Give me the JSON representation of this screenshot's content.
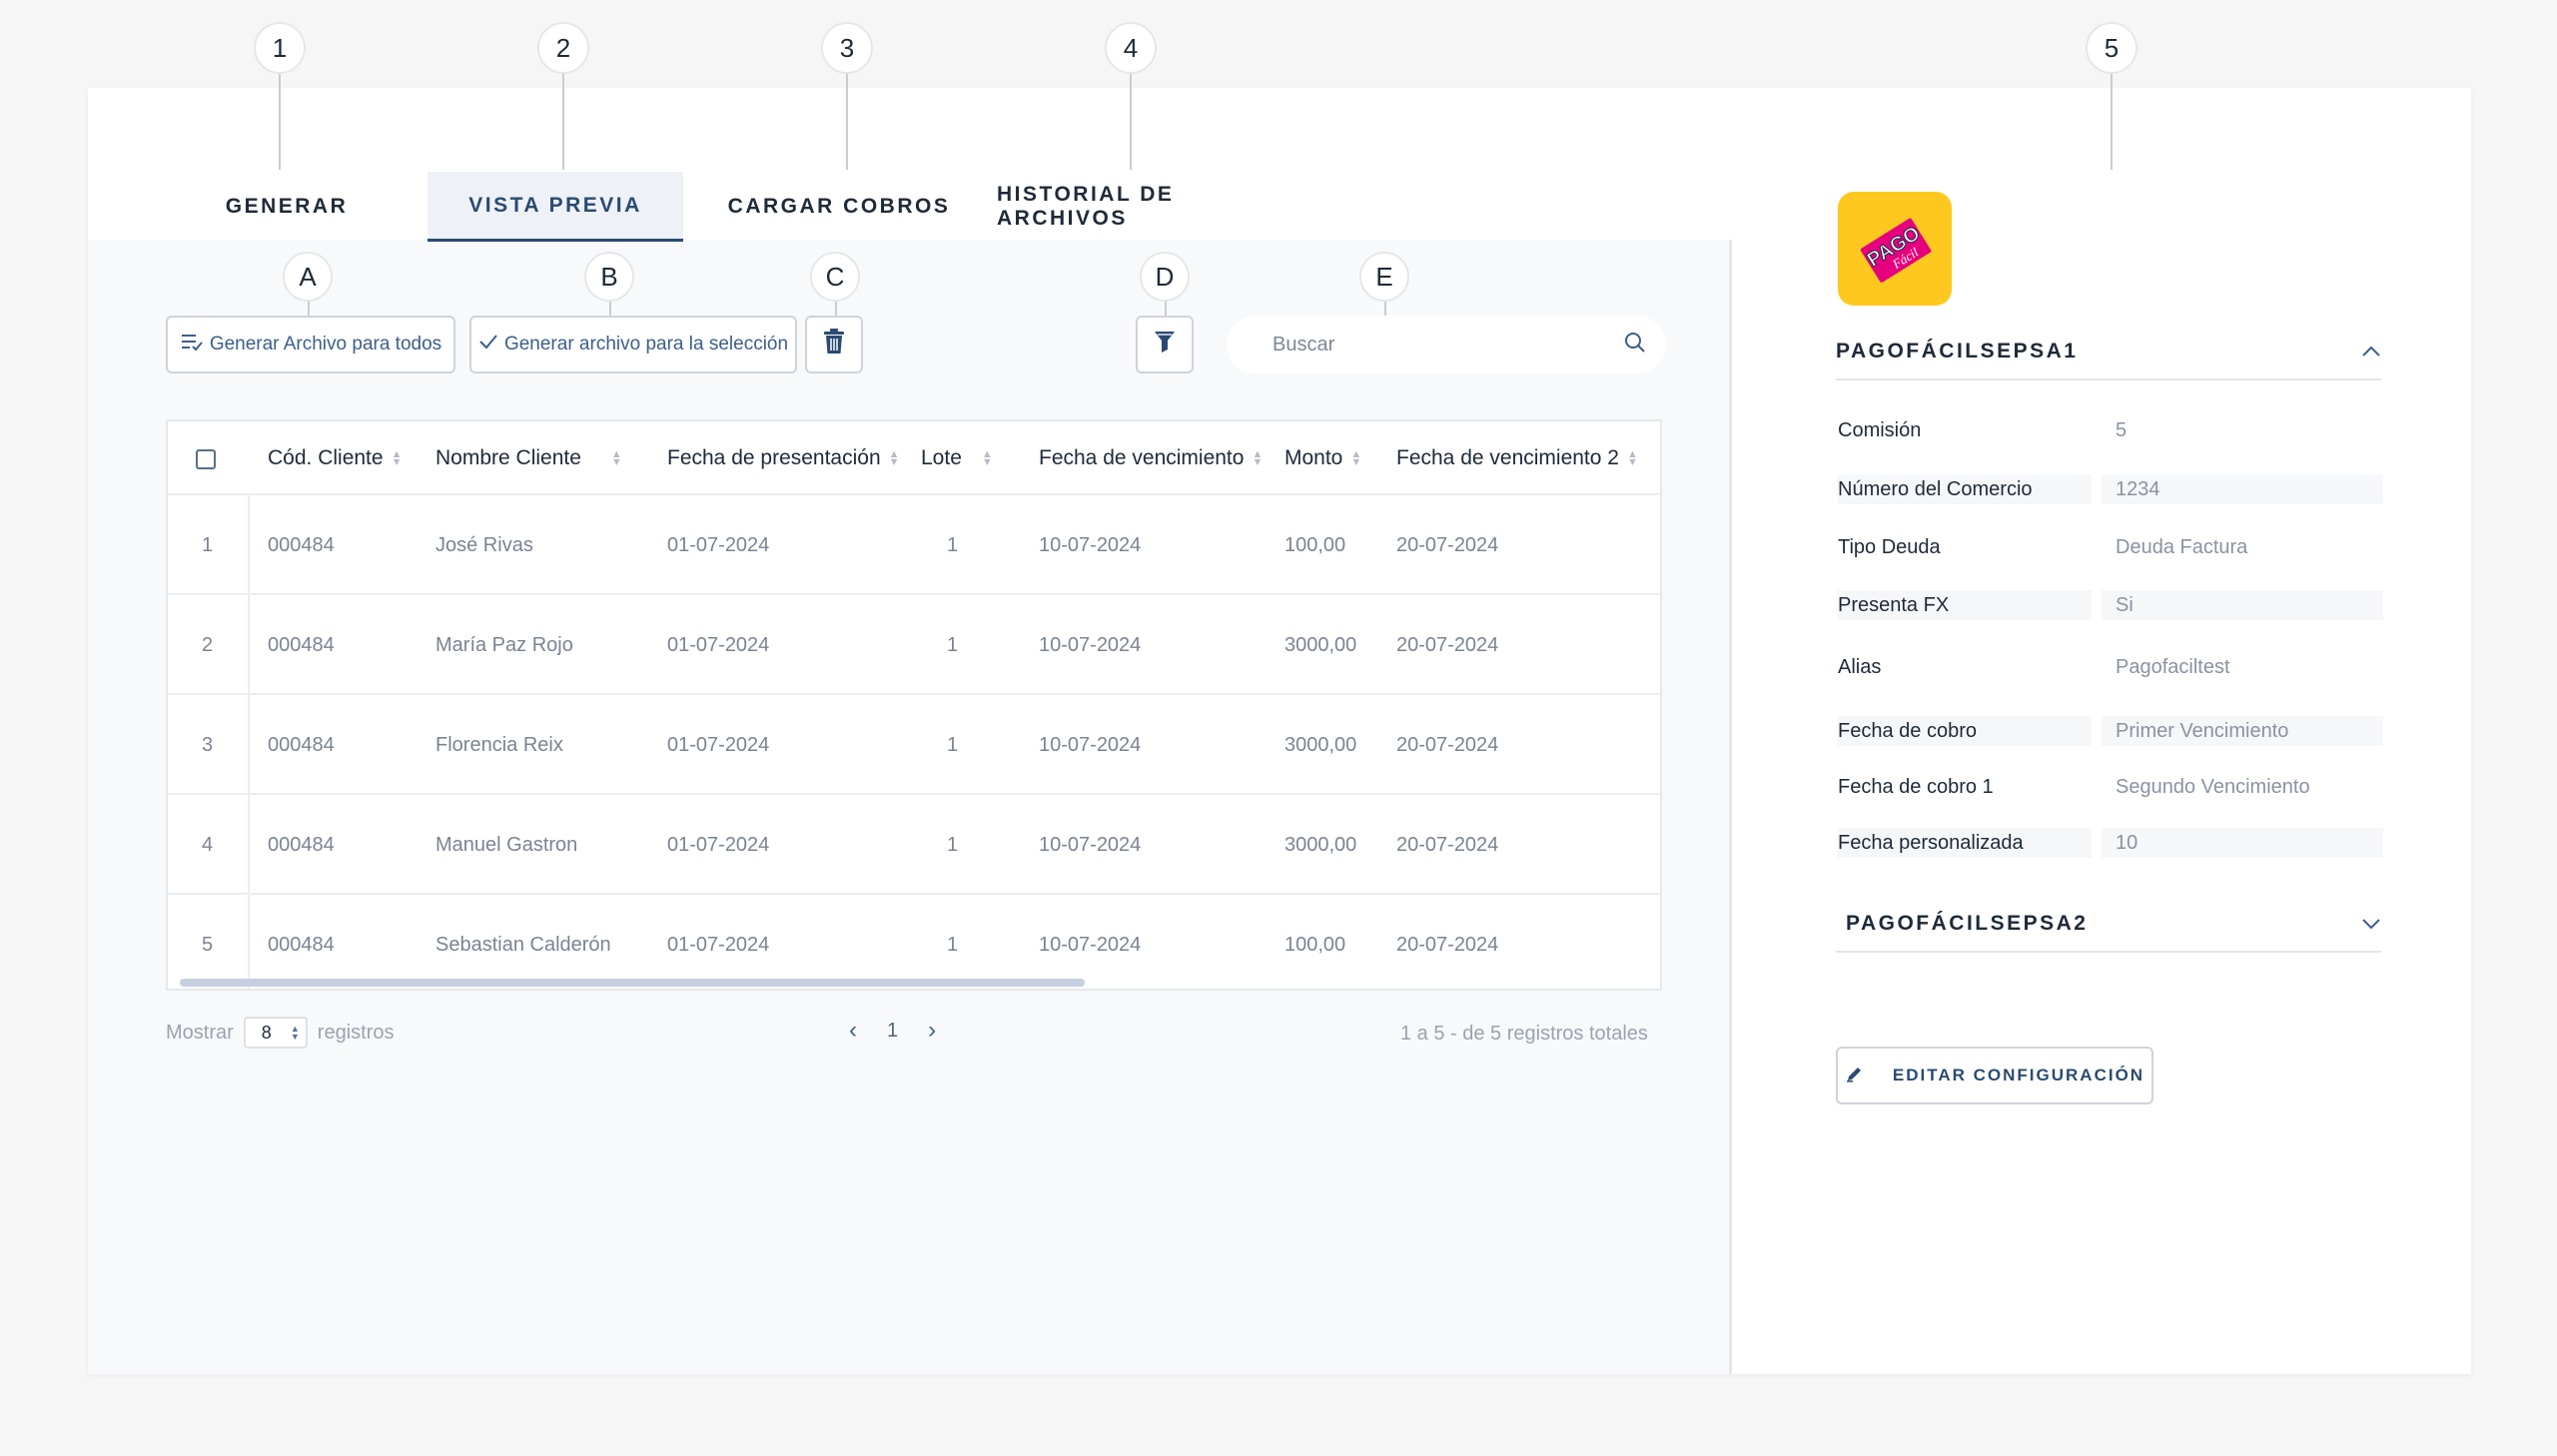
{
  "callouts": {
    "c1": "1",
    "c2": "2",
    "c3": "3",
    "c4": "4",
    "c5": "5",
    "cA": "A",
    "cB": "B",
    "cC": "C",
    "cD": "D",
    "cE": "E"
  },
  "tabs": {
    "generar": "GENERAR",
    "vista_previa": "VISTA PREVIA",
    "cargar_cobros": "CARGAR COBROS",
    "historial": "HISTORIAL DE ARCHIVOS"
  },
  "toolbar": {
    "generate_all": "Generar Archivo para todos",
    "generate_selection": "Generar archivo para la selección",
    "search_placeholder": "Buscar"
  },
  "table": {
    "headers": {
      "cod_cliente": "Cód. Cliente",
      "nombre_cliente": "Nombre Cliente",
      "fecha_presentacion": "Fecha de presentación",
      "lote": "Lote",
      "fecha_vencimiento": "Fecha de vencimiento",
      "monto": "Monto",
      "fecha_vencimiento_2": "Fecha de vencimiento 2"
    },
    "rows": [
      {
        "idx": "1",
        "cod": "000484",
        "nombre": "José Rivas",
        "presentacion": "01-07-2024",
        "lote": "1",
        "vencimiento": "10-07-2024",
        "monto": "100,00",
        "vencimiento2": "20-07-2024"
      },
      {
        "idx": "2",
        "cod": "000484",
        "nombre": "María Paz Rojo",
        "presentacion": "01-07-2024",
        "lote": "1",
        "vencimiento": "10-07-2024",
        "monto": "3000,00",
        "vencimiento2": "20-07-2024"
      },
      {
        "idx": "3",
        "cod": "000484",
        "nombre": "Florencia Reix",
        "presentacion": "01-07-2024",
        "lote": "1",
        "vencimiento": "10-07-2024",
        "monto": "3000,00",
        "vencimiento2": "20-07-2024"
      },
      {
        "idx": "4",
        "cod": "000484",
        "nombre": "Manuel Gastron",
        "presentacion": "01-07-2024",
        "lote": "1",
        "vencimiento": "10-07-2024",
        "monto": "3000,00",
        "vencimiento2": "20-07-2024"
      },
      {
        "idx": "5",
        "cod": "000484",
        "nombre": "Sebastian Calderón",
        "presentacion": "01-07-2024",
        "lote": "1",
        "vencimiento": "10-07-2024",
        "monto": "100,00",
        "vencimiento2": "20-07-2024"
      }
    ]
  },
  "pagination": {
    "show_label": "Mostrar",
    "page_size": "8",
    "records_label": "registros",
    "current_page": "1",
    "summary": "1 a 5 - de 5 registros totales"
  },
  "config": {
    "logo_text_top": "PAGO",
    "logo_text_bottom": "Fácil",
    "section1_title": "PAGOFÁCILSEPSA1",
    "section2_title": "PAGOFÁCILSEPSA2",
    "fields": [
      {
        "label": "Comisión",
        "value": "5"
      },
      {
        "label": "Número del Comercio",
        "value": "1234"
      },
      {
        "label": "Tipo Deuda",
        "value": "Deuda Factura"
      },
      {
        "label": "Presenta FX",
        "value": "Si"
      },
      {
        "label": "Alias",
        "value": "Pagofaciltest"
      },
      {
        "label": "Fecha de cobro",
        "value": "Primer Vencimiento"
      },
      {
        "label": "Fecha de cobro 1",
        "value": "Segundo Vencimiento"
      },
      {
        "label": "Fecha personalizada",
        "value": "10"
      }
    ],
    "edit_button": "EDITAR CONFIGURACIÓN"
  },
  "colors": {
    "accent": "#2a4a72",
    "logo_bg": "#ffc81f",
    "logo_fg": "#e6007e"
  }
}
